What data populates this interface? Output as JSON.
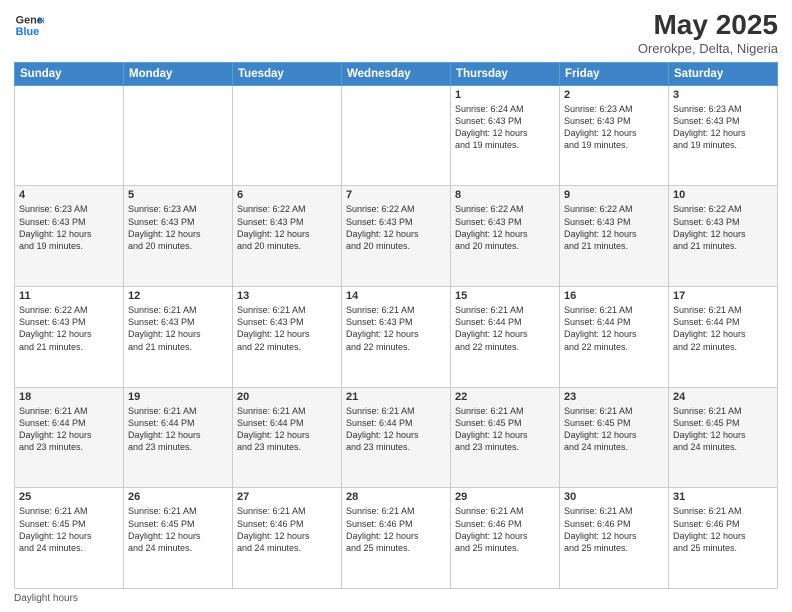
{
  "logo": {
    "general": "General",
    "blue": "Blue"
  },
  "header": {
    "month_title": "May 2025",
    "location": "Orerokpe, Delta, Nigeria"
  },
  "days_of_week": [
    "Sunday",
    "Monday",
    "Tuesday",
    "Wednesday",
    "Thursday",
    "Friday",
    "Saturday"
  ],
  "weeks": [
    [
      {
        "day": "",
        "info": ""
      },
      {
        "day": "",
        "info": ""
      },
      {
        "day": "",
        "info": ""
      },
      {
        "day": "",
        "info": ""
      },
      {
        "day": "1",
        "info": "Sunrise: 6:24 AM\nSunset: 6:43 PM\nDaylight: 12 hours\nand 19 minutes."
      },
      {
        "day": "2",
        "info": "Sunrise: 6:23 AM\nSunset: 6:43 PM\nDaylight: 12 hours\nand 19 minutes."
      },
      {
        "day": "3",
        "info": "Sunrise: 6:23 AM\nSunset: 6:43 PM\nDaylight: 12 hours\nand 19 minutes."
      }
    ],
    [
      {
        "day": "4",
        "info": "Sunrise: 6:23 AM\nSunset: 6:43 PM\nDaylight: 12 hours\nand 19 minutes."
      },
      {
        "day": "5",
        "info": "Sunrise: 6:23 AM\nSunset: 6:43 PM\nDaylight: 12 hours\nand 20 minutes."
      },
      {
        "day": "6",
        "info": "Sunrise: 6:22 AM\nSunset: 6:43 PM\nDaylight: 12 hours\nand 20 minutes."
      },
      {
        "day": "7",
        "info": "Sunrise: 6:22 AM\nSunset: 6:43 PM\nDaylight: 12 hours\nand 20 minutes."
      },
      {
        "day": "8",
        "info": "Sunrise: 6:22 AM\nSunset: 6:43 PM\nDaylight: 12 hours\nand 20 minutes."
      },
      {
        "day": "9",
        "info": "Sunrise: 6:22 AM\nSunset: 6:43 PM\nDaylight: 12 hours\nand 21 minutes."
      },
      {
        "day": "10",
        "info": "Sunrise: 6:22 AM\nSunset: 6:43 PM\nDaylight: 12 hours\nand 21 minutes."
      }
    ],
    [
      {
        "day": "11",
        "info": "Sunrise: 6:22 AM\nSunset: 6:43 PM\nDaylight: 12 hours\nand 21 minutes."
      },
      {
        "day": "12",
        "info": "Sunrise: 6:21 AM\nSunset: 6:43 PM\nDaylight: 12 hours\nand 21 minutes."
      },
      {
        "day": "13",
        "info": "Sunrise: 6:21 AM\nSunset: 6:43 PM\nDaylight: 12 hours\nand 22 minutes."
      },
      {
        "day": "14",
        "info": "Sunrise: 6:21 AM\nSunset: 6:43 PM\nDaylight: 12 hours\nand 22 minutes."
      },
      {
        "day": "15",
        "info": "Sunrise: 6:21 AM\nSunset: 6:44 PM\nDaylight: 12 hours\nand 22 minutes."
      },
      {
        "day": "16",
        "info": "Sunrise: 6:21 AM\nSunset: 6:44 PM\nDaylight: 12 hours\nand 22 minutes."
      },
      {
        "day": "17",
        "info": "Sunrise: 6:21 AM\nSunset: 6:44 PM\nDaylight: 12 hours\nand 22 minutes."
      }
    ],
    [
      {
        "day": "18",
        "info": "Sunrise: 6:21 AM\nSunset: 6:44 PM\nDaylight: 12 hours\nand 23 minutes."
      },
      {
        "day": "19",
        "info": "Sunrise: 6:21 AM\nSunset: 6:44 PM\nDaylight: 12 hours\nand 23 minutes."
      },
      {
        "day": "20",
        "info": "Sunrise: 6:21 AM\nSunset: 6:44 PM\nDaylight: 12 hours\nand 23 minutes."
      },
      {
        "day": "21",
        "info": "Sunrise: 6:21 AM\nSunset: 6:44 PM\nDaylight: 12 hours\nand 23 minutes."
      },
      {
        "day": "22",
        "info": "Sunrise: 6:21 AM\nSunset: 6:45 PM\nDaylight: 12 hours\nand 23 minutes."
      },
      {
        "day": "23",
        "info": "Sunrise: 6:21 AM\nSunset: 6:45 PM\nDaylight: 12 hours\nand 24 minutes."
      },
      {
        "day": "24",
        "info": "Sunrise: 6:21 AM\nSunset: 6:45 PM\nDaylight: 12 hours\nand 24 minutes."
      }
    ],
    [
      {
        "day": "25",
        "info": "Sunrise: 6:21 AM\nSunset: 6:45 PM\nDaylight: 12 hours\nand 24 minutes."
      },
      {
        "day": "26",
        "info": "Sunrise: 6:21 AM\nSunset: 6:45 PM\nDaylight: 12 hours\nand 24 minutes."
      },
      {
        "day": "27",
        "info": "Sunrise: 6:21 AM\nSunset: 6:46 PM\nDaylight: 12 hours\nand 24 minutes."
      },
      {
        "day": "28",
        "info": "Sunrise: 6:21 AM\nSunset: 6:46 PM\nDaylight: 12 hours\nand 25 minutes."
      },
      {
        "day": "29",
        "info": "Sunrise: 6:21 AM\nSunset: 6:46 PM\nDaylight: 12 hours\nand 25 minutes."
      },
      {
        "day": "30",
        "info": "Sunrise: 6:21 AM\nSunset: 6:46 PM\nDaylight: 12 hours\nand 25 minutes."
      },
      {
        "day": "31",
        "info": "Sunrise: 6:21 AM\nSunset: 6:46 PM\nDaylight: 12 hours\nand 25 minutes."
      }
    ]
  ],
  "footer": {
    "note": "Daylight hours"
  }
}
